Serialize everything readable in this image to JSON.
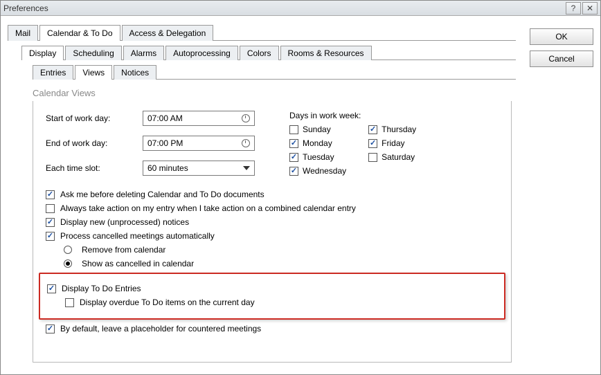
{
  "window": {
    "title": "Preferences"
  },
  "buttons": {
    "ok": "OK",
    "cancel": "Cancel"
  },
  "tabs": {
    "mail": "Mail",
    "cal": "Calendar & To Do",
    "access": "Access & Delegation"
  },
  "subtabs": {
    "display": "Display",
    "scheduling": "Scheduling",
    "alarms": "Alarms",
    "autoproc": "Autoprocessing",
    "colors": "Colors",
    "rooms": "Rooms & Resources"
  },
  "sstabs": {
    "entries": "Entries",
    "views": "Views",
    "notices": "Notices"
  },
  "group": {
    "title": "Calendar Views"
  },
  "labels": {
    "start": "Start of work day:",
    "end": "End of work day:",
    "slot": "Each time slot:",
    "daysheader": "Days in work week:"
  },
  "values": {
    "start": "07:00 AM",
    "end": "07:00 PM",
    "slot": "60 minutes"
  },
  "days": {
    "sun": "Sunday",
    "mon": "Monday",
    "tue": "Tuesday",
    "wed": "Wednesday",
    "thu": "Thursday",
    "fri": "Friday",
    "sat": "Saturday"
  },
  "opts": {
    "askdelete": "Ask me before deleting Calendar and To Do documents",
    "alwaysaction": "Always take action on my entry when I take action on a combined calendar entry",
    "dispnew": "Display new (unprocessed) notices",
    "proccancel": "Process cancelled meetings automatically",
    "remove": "Remove from calendar",
    "showcancel": "Show as cancelled in calendar",
    "disptodo": "Display To Do Entries",
    "dispoverdue": "Display overdue To Do items on the current day",
    "placeholder": "By default, leave a placeholder for countered meetings"
  }
}
